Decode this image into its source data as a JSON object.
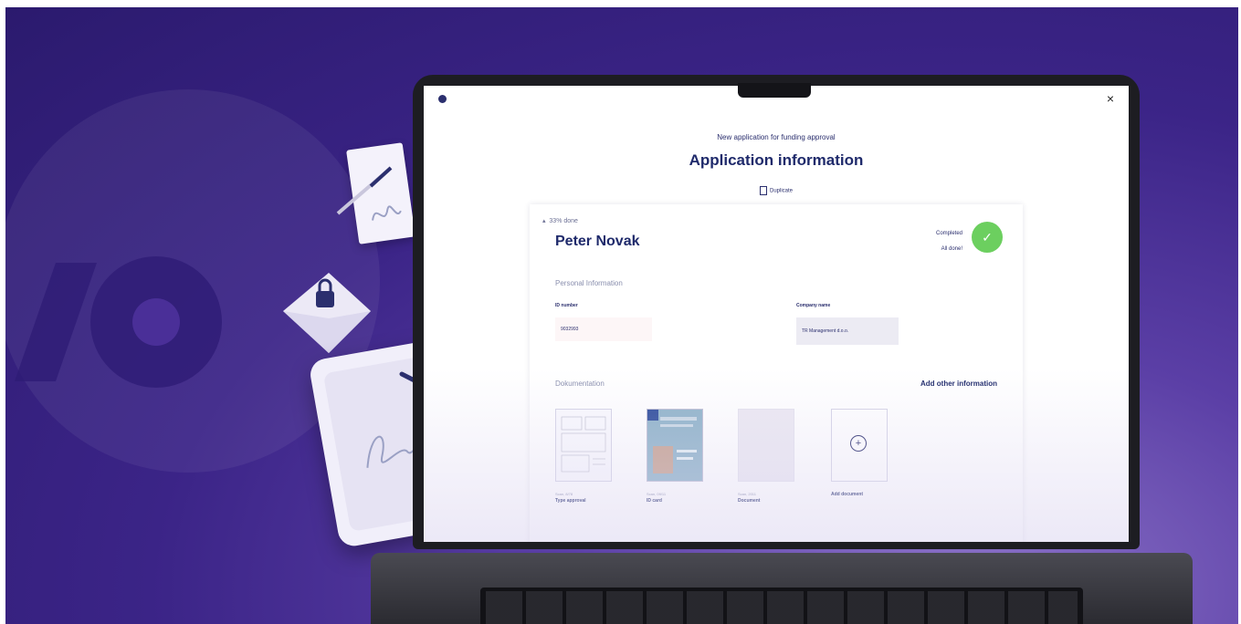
{
  "app": {
    "logo_text": "",
    "close_glyph": "×"
  },
  "header": {
    "subtitle": "New application for funding approval",
    "title": "Application information",
    "duplicate_label": "Duplicate"
  },
  "card": {
    "progress_label": "33% done",
    "progress_fraction": 0.33,
    "person_name": "Peter Novak",
    "status_label": "Completed",
    "status_sub": "All done!",
    "check_glyph": "✓",
    "personal_section": "Personal Information",
    "fields": [
      {
        "label": "ID number",
        "value": "9032993"
      },
      {
        "label": "Company name",
        "value": "TR Management d.o.o."
      }
    ],
    "documentation_section": "Dokumentation",
    "add_info_label": "Add other information",
    "documents": [
      {
        "meta": "Scan, 8/78",
        "label": "Type approval"
      },
      {
        "meta": "Scan, 09/11",
        "label": "ID card"
      },
      {
        "meta": "Scan, 2011",
        "label": "Document"
      },
      {
        "meta": "",
        "label": "Add document"
      }
    ],
    "add_glyph": "+"
  },
  "colors": {
    "brand_navy": "#1f2a6b",
    "background_purple": "#3b2487",
    "success_green": "#6ccf5f"
  }
}
